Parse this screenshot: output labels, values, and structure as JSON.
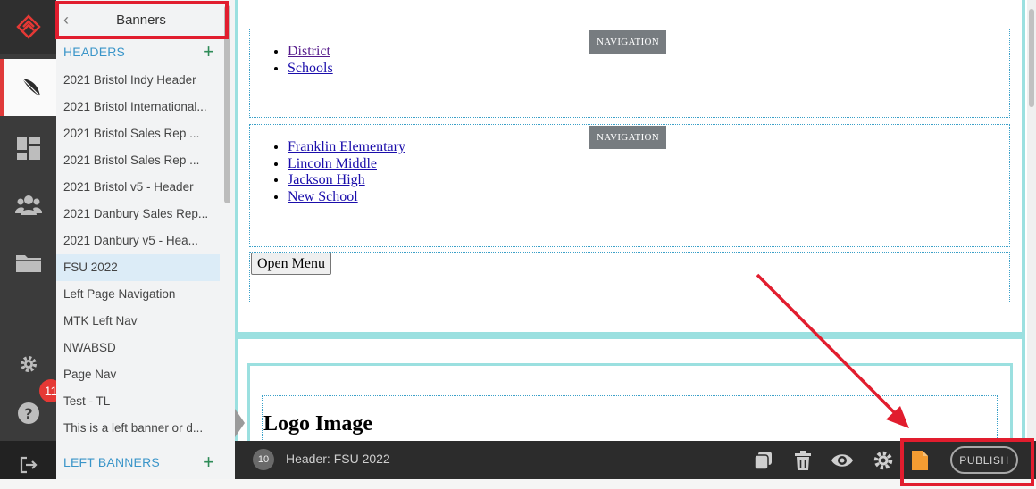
{
  "sidebar": {
    "header_title": "Banners",
    "back_glyph": "‹",
    "sections": [
      {
        "label": "HEADERS",
        "add": "+"
      },
      {
        "label": "LEFT BANNERS",
        "add": "+"
      }
    ],
    "items": [
      "2021 Bristol Indy Header",
      "2021 Bristol International...",
      "2021 Bristol Sales Rep ...",
      "2021 Bristol Sales Rep ...",
      "2021 Bristol v5 - Header",
      "2021 Danbury Sales Rep...",
      "2021 Danbury v5 - Hea...",
      "FSU 2022",
      "Left Page Navigation",
      "MTK Left Nav",
      "NWABSD",
      "Page Nav",
      "Test - TL",
      "This is a left banner or d..."
    ],
    "active_index": 7
  },
  "rail": {
    "badge": "11",
    "icons": [
      "logo-icon",
      "feather-icon",
      "dashboard-icon",
      "users-icon",
      "folder-icon",
      "gear-icon",
      "help-icon",
      "logout-icon"
    ]
  },
  "canvas": {
    "nav_tag": "NAVIGATION",
    "nav1": [
      "District",
      "Schools"
    ],
    "nav2": [
      "Franklin Elementary",
      "Lincoln Middle",
      "Jackson High",
      "New School"
    ],
    "open_menu": "Open Menu",
    "logo_title": "Logo Image"
  },
  "bottombar": {
    "count": "10",
    "title": "Header: FSU 2022",
    "publish": "PUBLISH",
    "icons": [
      "duplicate-icon",
      "trash-icon",
      "eye-icon",
      "gear-icon",
      "page-icon"
    ]
  },
  "colors": {
    "accent_blue": "#3a95c9",
    "add_green": "#2e8b57",
    "highlight_red": "#e11d2e",
    "frame_teal": "#9be0e0",
    "page_orange": "#f39c32"
  }
}
